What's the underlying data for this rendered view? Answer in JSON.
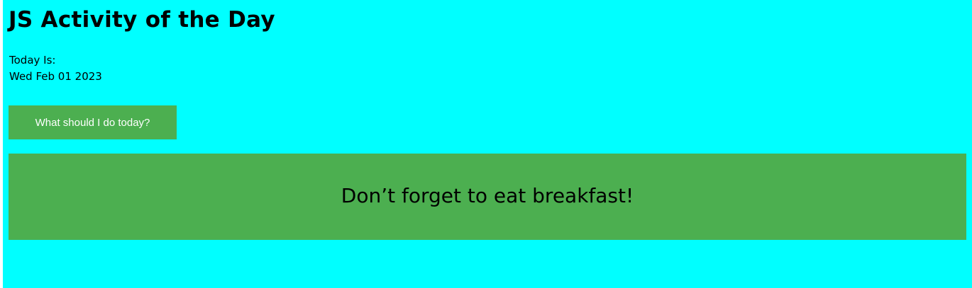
{
  "header": {
    "title": "JS Activity of the Day"
  },
  "today": {
    "label": "Today Is:",
    "date": "Wed Feb 01 2023"
  },
  "actions": {
    "button_label": "What should I do today?"
  },
  "message": {
    "text": "Don’t forget to eat breakfast!"
  },
  "colors": {
    "background": "#00ffff",
    "accent": "#4caf50",
    "button_text": "#ffffff"
  }
}
